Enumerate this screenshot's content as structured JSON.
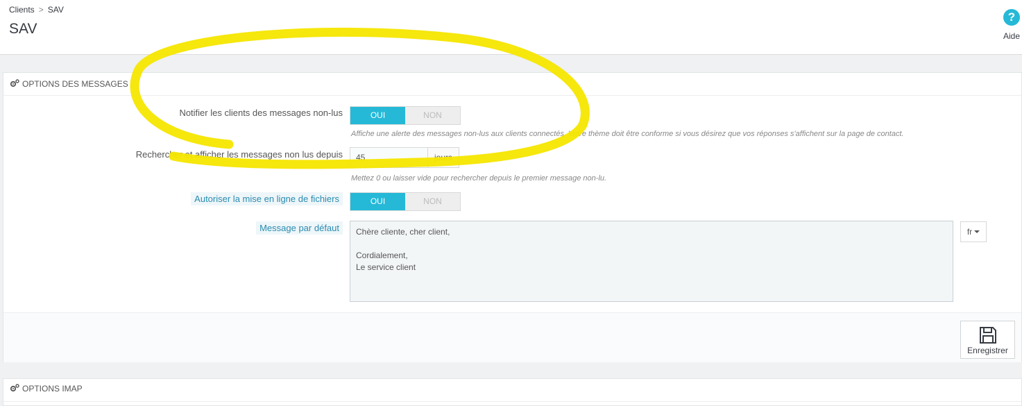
{
  "breadcrumb": {
    "parent": "Clients",
    "separator": ">",
    "current": "SAV"
  },
  "page_title": "SAV",
  "help": {
    "label": "Aide"
  },
  "panel": {
    "title": "OPTIONS DES MESSAGES",
    "notify": {
      "label": "Notifier les clients des messages non-lus",
      "on_label": "OUI",
      "off_label": "NON",
      "help": "Affiche une alerte des messages non-lus aux clients connectés. Votre thème doit être conforme si vous désirez que vos réponses s'affichent sur la page de contact."
    },
    "search": {
      "label": "Rechercher et afficher les messages non lus depuis",
      "value": "45",
      "suffix": "jours",
      "help": "Mettez 0 ou laisser vide pour rechercher depuis le premier message non-lu."
    },
    "upload": {
      "label": "Autoriser la mise en ligne de fichiers",
      "on_label": "OUI",
      "off_label": "NON"
    },
    "default_message": {
      "label": "Message par défaut",
      "value": "Chère cliente, cher client,\n\nCordialement,\nLe service client",
      "lang": "fr"
    },
    "save_label": "Enregistrer"
  },
  "panel2": {
    "title": "OPTIONS IMAP"
  },
  "colors": {
    "accent": "#25b9d7",
    "highlight": "#f5e600"
  },
  "icons": {
    "help": "question-circle-icon",
    "gears": "cogs-icon",
    "save": "floppy-disk-icon",
    "caret": "caret-down-icon"
  }
}
